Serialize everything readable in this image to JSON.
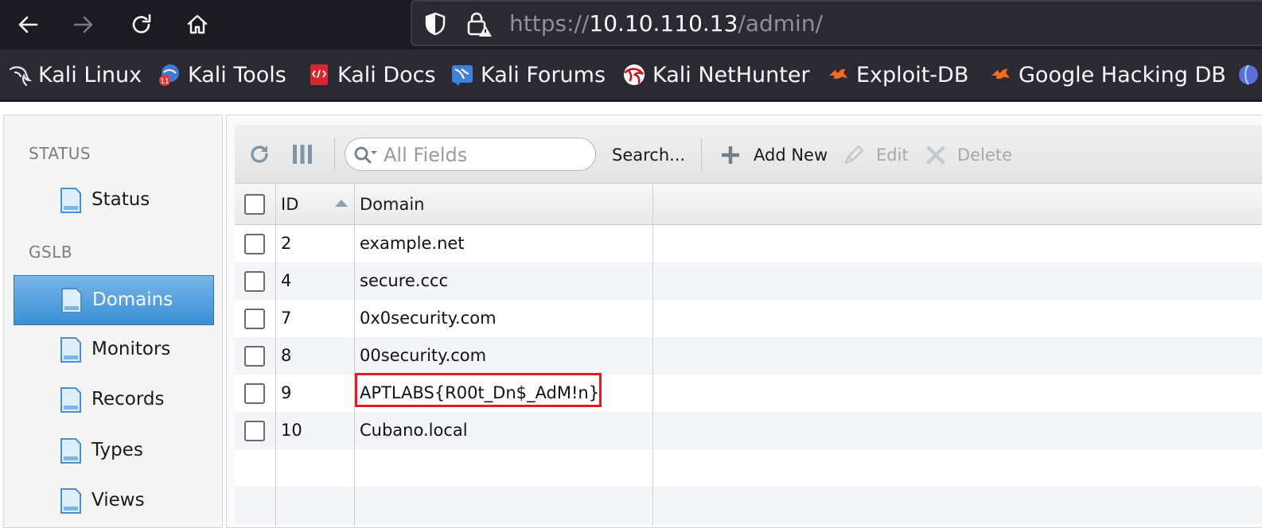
{
  "browser": {
    "url_scheme": "https://",
    "url_host": "10.10.110.13",
    "url_path": "/admin/",
    "bookmarks": [
      {
        "label": "Kali Linux",
        "icon": "kali-dragon-icon"
      },
      {
        "label": "Kali Tools",
        "icon": "kali-tools-icon"
      },
      {
        "label": "Kali Docs",
        "icon": "kali-docs-icon"
      },
      {
        "label": "Kali Forums",
        "icon": "kali-forums-icon"
      },
      {
        "label": "Kali NetHunter",
        "icon": "kali-nethunter-icon"
      },
      {
        "label": "Exploit-DB",
        "icon": "exploit-db-icon"
      },
      {
        "label": "Google Hacking DB",
        "icon": "google-hacking-db-icon"
      }
    ]
  },
  "sidebar": {
    "sections": [
      {
        "title": "STATUS",
        "items": [
          {
            "label": "Status",
            "active": false
          }
        ]
      },
      {
        "title": "GSLB",
        "items": [
          {
            "label": "Domains",
            "active": true
          },
          {
            "label": "Monitors",
            "active": false
          },
          {
            "label": "Records",
            "active": false
          },
          {
            "label": "Types",
            "active": false
          },
          {
            "label": "Views",
            "active": false
          }
        ]
      }
    ]
  },
  "toolbar": {
    "search_placeholder": "All Fields",
    "search_button": "Search...",
    "add_label": "Add New",
    "edit_label": "Edit",
    "delete_label": "Delete"
  },
  "grid": {
    "columns": [
      "ID",
      "Domain"
    ],
    "sort_column": "ID",
    "sort_direction": "ascending",
    "rows": [
      {
        "id": "2",
        "domain": "example.net"
      },
      {
        "id": "4",
        "domain": "secure.ccc"
      },
      {
        "id": "7",
        "domain": "0x0security.com"
      },
      {
        "id": "8",
        "domain": "00security.com"
      },
      {
        "id": "9",
        "domain": "APTLABS{R00t_Dn$_AdM!n}",
        "highlighted": true
      },
      {
        "id": "10",
        "domain": "Cubano.local"
      }
    ]
  },
  "colors": {
    "chrome_bg": "#1c1b22",
    "toolbar_bg": "#2b2a33",
    "active_item": "#4a9be0",
    "highlight_border": "#e31b23"
  }
}
